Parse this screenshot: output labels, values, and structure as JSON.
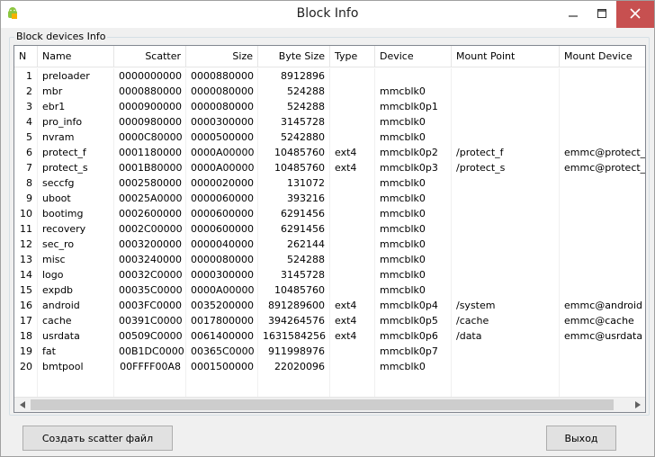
{
  "window": {
    "title": "Block Info",
    "icons": {
      "app": "android-tool-icon",
      "minimize": "minimize-icon",
      "maximize": "maximize-icon",
      "close": "close-icon"
    }
  },
  "group": {
    "label": "Block devices Info"
  },
  "table": {
    "columns": [
      "N",
      "Name",
      "Scatter",
      "Size",
      "Byte Size",
      "Type",
      "Device",
      "Mount Point",
      "Mount Device"
    ],
    "rows": [
      [
        "1",
        "preloader",
        "0000000000",
        "0000880000",
        "8912896",
        "",
        "",
        "",
        ""
      ],
      [
        "2",
        "mbr",
        "0000880000",
        "0000080000",
        "524288",
        "",
        "mmcblk0",
        "",
        ""
      ],
      [
        "3",
        "ebr1",
        "0000900000",
        "0000080000",
        "524288",
        "",
        "mmcblk0p1",
        "",
        ""
      ],
      [
        "4",
        "pro_info",
        "0000980000",
        "0000300000",
        "3145728",
        "",
        "mmcblk0",
        "",
        ""
      ],
      [
        "5",
        "nvram",
        "0000C80000",
        "0000500000",
        "5242880",
        "",
        "mmcblk0",
        "",
        ""
      ],
      [
        "6",
        "protect_f",
        "0001180000",
        "0000A00000",
        "10485760",
        "ext4",
        "mmcblk0p2",
        "/protect_f",
        "emmc@protect_"
      ],
      [
        "7",
        "protect_s",
        "0001B80000",
        "0000A00000",
        "10485760",
        "ext4",
        "mmcblk0p3",
        "/protect_s",
        "emmc@protect_"
      ],
      [
        "8",
        "seccfg",
        "0002580000",
        "0000020000",
        "131072",
        "",
        "mmcblk0",
        "",
        ""
      ],
      [
        "9",
        "uboot",
        "00025A0000",
        "0000060000",
        "393216",
        "",
        "mmcblk0",
        "",
        ""
      ],
      [
        "10",
        "bootimg",
        "0002600000",
        "0000600000",
        "6291456",
        "",
        "mmcblk0",
        "",
        ""
      ],
      [
        "11",
        "recovery",
        "0002C00000",
        "0000600000",
        "6291456",
        "",
        "mmcblk0",
        "",
        ""
      ],
      [
        "12",
        "sec_ro",
        "0003200000",
        "0000040000",
        "262144",
        "",
        "mmcblk0",
        "",
        ""
      ],
      [
        "13",
        "misc",
        "0003240000",
        "0000080000",
        "524288",
        "",
        "mmcblk0",
        "",
        ""
      ],
      [
        "14",
        "logo",
        "00032C0000",
        "0000300000",
        "3145728",
        "",
        "mmcblk0",
        "",
        ""
      ],
      [
        "15",
        "expdb",
        "00035C0000",
        "0000A00000",
        "10485760",
        "",
        "mmcblk0",
        "",
        ""
      ],
      [
        "16",
        "android",
        "0003FC0000",
        "0035200000",
        "891289600",
        "ext4",
        "mmcblk0p4",
        "/system",
        "emmc@android"
      ],
      [
        "17",
        "cache",
        "00391C0000",
        "0017800000",
        "394264576",
        "ext4",
        "mmcblk0p5",
        "/cache",
        "emmc@cache"
      ],
      [
        "18",
        "usrdata",
        "00509C0000",
        "0061400000",
        "1631584256",
        "ext4",
        "mmcblk0p6",
        "/data",
        "emmc@usrdata"
      ],
      [
        "19",
        "fat",
        "00B1DC0000",
        "00365C0000",
        "911998976",
        "",
        "mmcblk0p7",
        "",
        ""
      ],
      [
        "20",
        "bmtpool",
        "00FFFF00A8",
        "0001500000",
        "22020096",
        "",
        "mmcblk0",
        "",
        ""
      ]
    ]
  },
  "buttons": {
    "scatter": "Создать scatter файл",
    "exit": "Выход"
  }
}
